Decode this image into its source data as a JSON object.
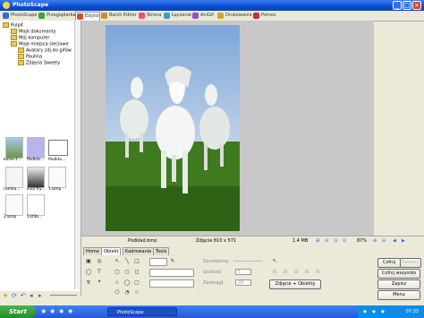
{
  "window": {
    "title": "PhotoScape"
  },
  "tabs": [
    {
      "label": "PhotoScape",
      "color": "#2a6fd6"
    },
    {
      "label": "Przeglądarka",
      "color": "#38a838"
    },
    {
      "label": "Edytor",
      "color": "#d84a2a"
    },
    {
      "label": "Batch Editor",
      "color": "#d68a2a"
    },
    {
      "label": "Strona",
      "color": "#e84a8a"
    },
    {
      "label": "Łączenie",
      "color": "#3a9ad6"
    },
    {
      "label": "AniGif",
      "color": "#9a4ad6"
    },
    {
      "label": "Drukowanie",
      "color": "#d6a02a"
    },
    {
      "label": "Pomoc",
      "color": "#c83030"
    }
  ],
  "tree": {
    "root": "Pulpit",
    "items": [
      {
        "label": "Moje dokumenty"
      },
      {
        "label": "Mój komputer"
      },
      {
        "label": "Moje miejsca sieciowe"
      },
      {
        "label": "Avatary zdj.do gifów"
      },
      {
        "label": "Paulina"
      },
      {
        "label": "Zdjęcia Sweety"
      }
    ]
  },
  "thumbnails": [
    {
      "label": "konie-t..."
    },
    {
      "label": "Podkła..."
    },
    {
      "label": "Podkła..."
    },
    {
      "label": "ramka..."
    },
    {
      "label": "siva fry..."
    },
    {
      "label": "1.bmp"
    },
    {
      "label": "2.bmp"
    },
    {
      "label": "13f3b..."
    }
  ],
  "status": {
    "filename": "Podkład.bmp",
    "dimensions": "Zdjęcie 810 x 571",
    "size": "1.4 MB",
    "zoom": "87%"
  },
  "editor_tabs": [
    {
      "label": "Home"
    },
    {
      "label": "Obiekt"
    },
    {
      "label": "Kadrowanie"
    },
    {
      "label": "Tools"
    }
  ],
  "object_props": {
    "zaczepiony": "Zaczepiony",
    "grubosc": "Grubość",
    "grubosc_value": "5",
    "zaokraglij": "Zaokrągl.",
    "zaokraglij_value": "20",
    "combine_button": "Zdjęcie + Obiekty"
  },
  "right_buttons": {
    "undo": "Cofnij",
    "redo": "Powtórz",
    "undo_all": "Cofnij wszystko",
    "save": "Zapisz",
    "menu": "Menu"
  },
  "taskbar": {
    "start": "Start",
    "app": "PhotoScape",
    "clock": "07:33"
  }
}
